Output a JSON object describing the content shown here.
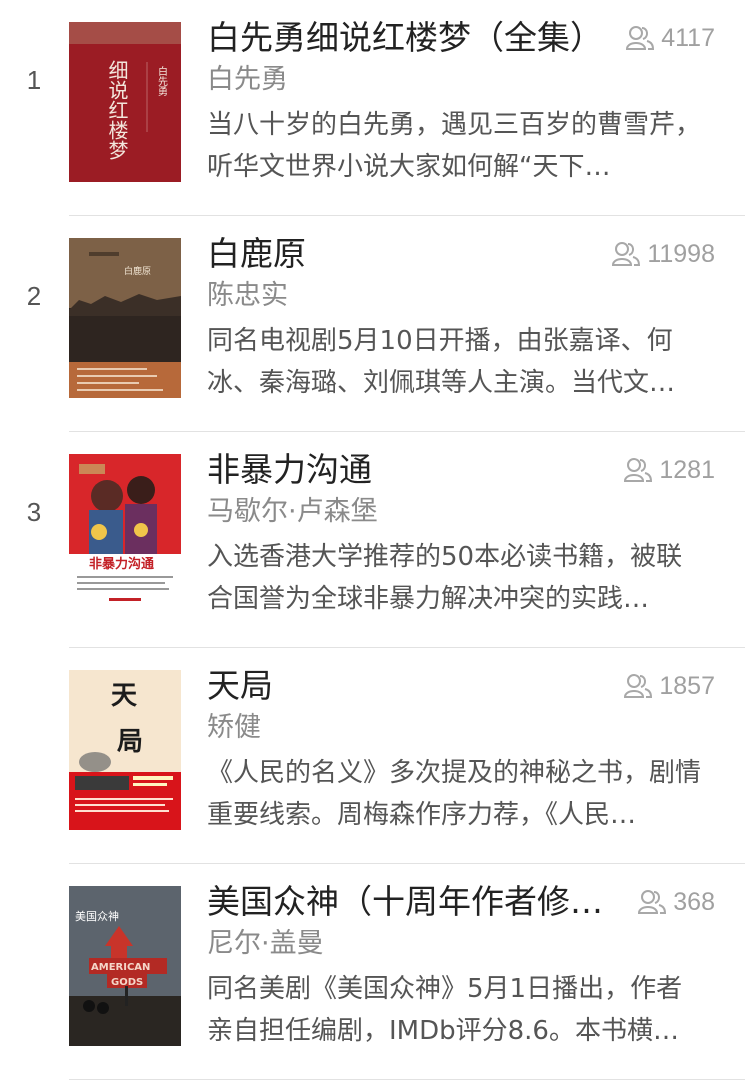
{
  "books": [
    {
      "rank": "1",
      "title": "白先勇细说红楼梦（全集）",
      "readers": "4117",
      "author": "白先勇",
      "desc": "当八十岁的白先勇，遇见三百岁的曹雪芹，听华文世界小说大家如何解“天下…",
      "cover_text": [
        "白先勇",
        "细说红楼梦"
      ]
    },
    {
      "rank": "2",
      "title": "白鹿原",
      "readers": "11998",
      "author": "陈忠实",
      "desc": "同名电视剧5月10日开播，由张嘉译、何冰、秦海璐、刘佩琪等人主演。当代文…",
      "cover_text": [
        "白鹿原"
      ]
    },
    {
      "rank": "3",
      "title": "非暴力沟通",
      "readers": "1281",
      "author": "马歇尔·卢森堡",
      "desc": "入选香港大学推荐的50本必读书籍，被联合国誉为全球非暴力解决冲突的实践…",
      "cover_text": [
        "非暴力沟通"
      ]
    },
    {
      "rank": "",
      "title": "天局",
      "readers": "1857",
      "author": "矫健",
      "desc": "《人民的名义》多次提及的神秘之书，剧情重要线索。周梅森作序力荐，《人民…",
      "cover_text": [
        "天",
        "局"
      ]
    },
    {
      "rank": "",
      "title": "美国众神（十周年作者修订版）",
      "readers": "368",
      "author": "尼尔·盖曼",
      "desc": "同名美剧《美国众神》5月1日播出，作者亲自担任编剧，IMDb评分8.6。本书横…",
      "cover_text": [
        "美国众神",
        "AMERICAN",
        "GODS"
      ]
    }
  ]
}
